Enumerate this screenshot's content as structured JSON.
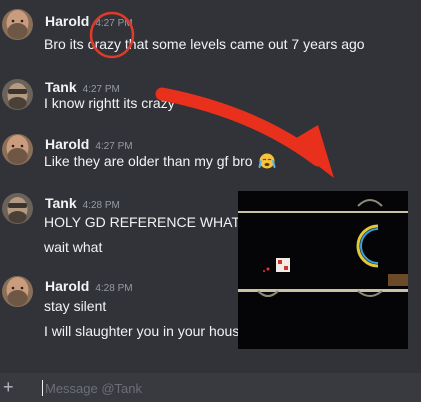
{
  "messages": [
    {
      "author": "Harold",
      "time": "4:27 PM",
      "lines": [
        "Bro its crazy that some levels came out 7 years ago"
      ]
    },
    {
      "author": "Tank",
      "time": "4:27 PM",
      "lines": [
        "I know rightt its crazy"
      ]
    },
    {
      "author": "Harold",
      "time": "4:27 PM",
      "lines": [
        "Like they are older than my gf bro"
      ],
      "emoji": "crying-face"
    },
    {
      "author": "Tank",
      "time": "4:28 PM",
      "lines": [
        "HOLY GD REFERENCE WHAT",
        "wait what"
      ]
    },
    {
      "author": "Harold",
      "time": "4:28 PM",
      "lines": [
        "stay silent",
        "I will slaughter you in your hous"
      ]
    }
  ],
  "composer": {
    "placeholder": "Message @Tank",
    "add_icon": "plus-icon"
  },
  "annotations": {
    "circle_color": "#e23a2a",
    "arrow_color": "#e8301c"
  },
  "icons": [
    "harold-avatar",
    "tank-avatar",
    "crying-emoji-icon",
    "plus-icon"
  ]
}
